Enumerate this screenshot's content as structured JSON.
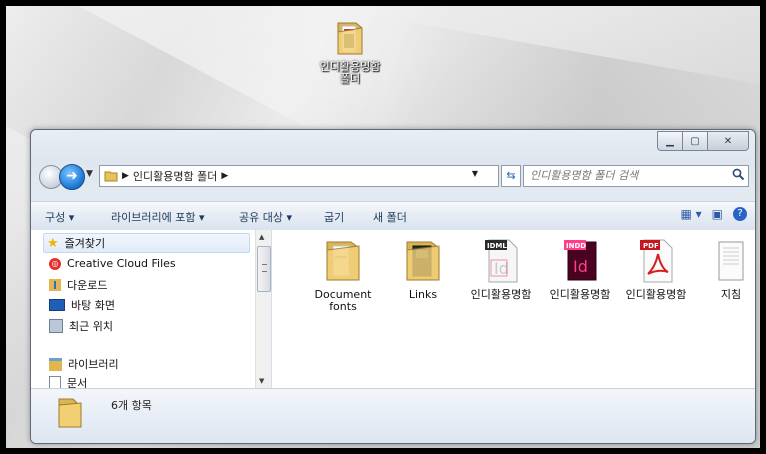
{
  "desktop": {
    "icon_label": "인디활용명함\n폴더"
  },
  "window": {
    "breadcrumb": "인디활용명함 폴더",
    "search_placeholder": "인디활용명함 폴더 검색",
    "toolbar": {
      "organize": "구성 ▾",
      "include_library": "라이브러리에 포함 ▾",
      "share": "공유 대상 ▾",
      "burn": "굽기",
      "new_folder": "새 폴더"
    },
    "nav": {
      "favorites": "즐겨찾기",
      "creative_cloud": "Creative Cloud Files",
      "downloads": "다운로드",
      "desktop": "바탕 화면",
      "recent": "최근 위치",
      "libraries": "라이브러리",
      "documents": "문서"
    },
    "files": [
      {
        "name": "Document fonts",
        "type": "folder-docs"
      },
      {
        "name": "Links",
        "type": "folder-links"
      },
      {
        "name": "인디활용명함",
        "type": "idml"
      },
      {
        "name": "인디활용명함",
        "type": "indd"
      },
      {
        "name": "인디활용명함",
        "type": "pdf"
      },
      {
        "name": "지침",
        "type": "txt"
      }
    ],
    "status": "6개 항목"
  }
}
